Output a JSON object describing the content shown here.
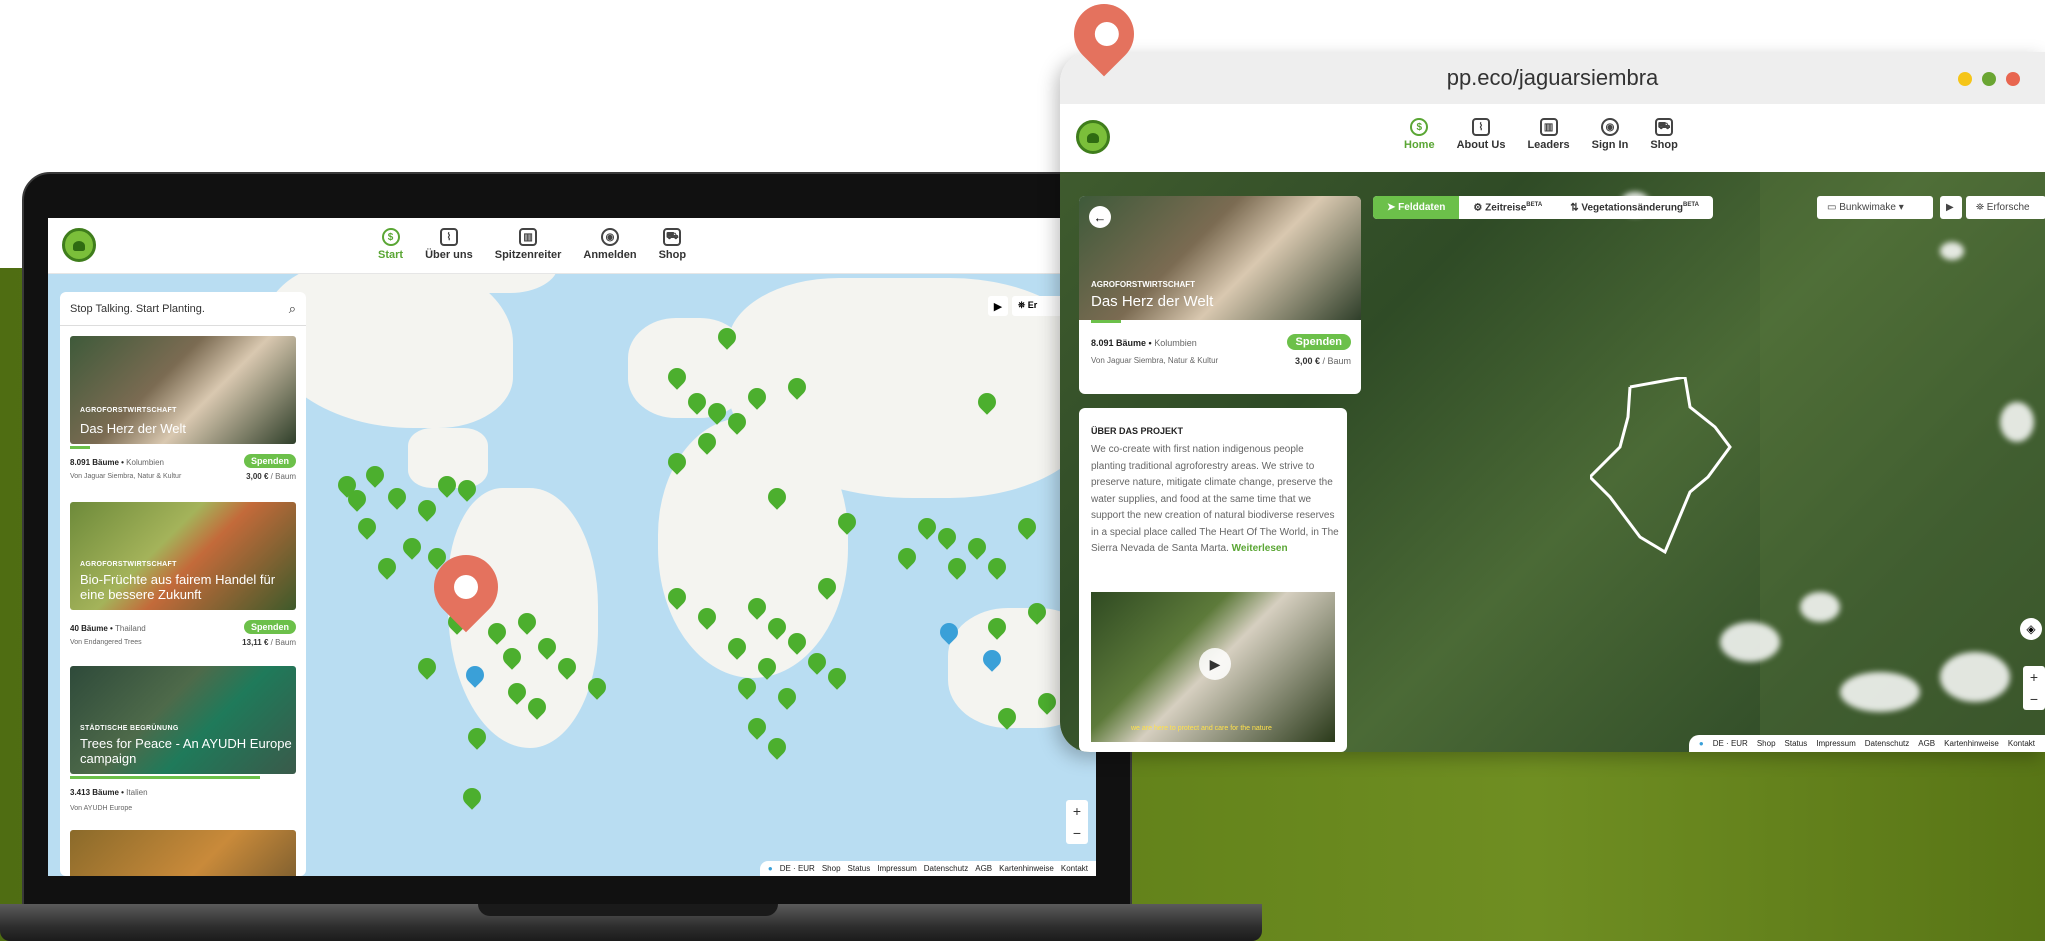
{
  "laptop": {
    "nav": {
      "items": [
        {
          "label": "Start",
          "icon": "donate-icon",
          "active": true
        },
        {
          "label": "Über uns",
          "icon": "leaf-icon"
        },
        {
          "label": "Spitzenreiter",
          "icon": "leaderboard-icon"
        },
        {
          "label": "Anmelden",
          "icon": "user-icon"
        },
        {
          "label": "Shop",
          "icon": "cart-icon"
        }
      ]
    },
    "search": {
      "placeholder": "Stop Talking. Start Planting."
    },
    "cards": [
      {
        "category": "AGROFORSTWIRTSCHAFT",
        "title": "Das Herz der Welt",
        "trees": "8.091 Bäume",
        "country": "Kolumbien",
        "by": "Von Jaguar Siembra, Natur & Kultur",
        "cta": "Spenden",
        "price": "3,00 €",
        "unit": "/ Baum"
      },
      {
        "category": "AGROFORSTWIRTSCHAFT",
        "title": "Bio-Früchte aus fairem Handel für eine bessere Zukunft",
        "trees": "40 Bäume",
        "country": "Thailand",
        "by": "Von Endangered Trees",
        "cta": "Spenden",
        "price": "13,11 €",
        "unit": "/ Baum"
      },
      {
        "category": "STÄDTISCHE BEGRÜNUNG",
        "title": "Trees for Peace - An AYUDH Europe campaign",
        "trees": "3.413 Bäume",
        "country": "Italien",
        "by": "Von AYUDH Europe"
      }
    ],
    "map_controls": {
      "play": "▶",
      "explore": "Er"
    },
    "zoom": {
      "in": "+",
      "out": "−"
    },
    "footer": [
      "DE · EUR",
      "Shop",
      "Status",
      "Impressum",
      "Datenschutz",
      "AGB",
      "Kartenhinweise",
      "Kontakt"
    ]
  },
  "browser": {
    "url": "pp.eco/jaguarsiembra",
    "window_dots": {
      "colors": [
        "#f5c518",
        "#6aa532",
        "#e8654f"
      ]
    },
    "nav": {
      "items": [
        {
          "label": "Home",
          "icon": "donate-icon",
          "active": true
        },
        {
          "label": "About Us",
          "icon": "leaf-icon"
        },
        {
          "label": "Leaders",
          "icon": "leaderboard-icon"
        },
        {
          "label": "Sign In",
          "icon": "user-icon"
        },
        {
          "label": "Shop",
          "icon": "cart-icon"
        }
      ]
    },
    "project": {
      "category": "AGROFORSTWIRTSCHAFT",
      "title": "Das Herz der Welt",
      "trees": "8.091 Bäume",
      "country": "Kolumbien",
      "by": "Von Jaguar Siembra, Natur & Kultur",
      "cta": "Spenden",
      "price": "3,00 €",
      "unit": "/ Baum"
    },
    "about": {
      "heading": "ÜBER DAS PROJEKT",
      "text": "We co-create with first nation indigenous people planting traditional agroforestry areas. We strive to preserve nature, mitigate climate change, preserve the water supplies, and food at the same time that we support the new creation of natural biodiverse reserves in a special place called The Heart Of The World, in The Sierra Nevada de Santa Marta.",
      "more": "Weiterlesen",
      "video_caption": "we are here to protect and care for the nature"
    },
    "tabs": [
      {
        "label": "Felddaten",
        "active": true
      },
      {
        "label": "Zeitreise",
        "badge": "BETA"
      },
      {
        "label": "Vegetationsänderung",
        "badge": "BETA"
      }
    ],
    "map_select": "Bunkwimake",
    "explore": "Erforsche",
    "footer": [
      "DE · EUR",
      "Shop",
      "Status",
      "Impressum",
      "Datenschutz",
      "AGB",
      "Kartenhinweise",
      "Kontakt"
    ]
  },
  "colors": {
    "brand_green": "#6cc04a",
    "pin_orange": "#e4725e",
    "bg_green": "#5d7d17"
  }
}
